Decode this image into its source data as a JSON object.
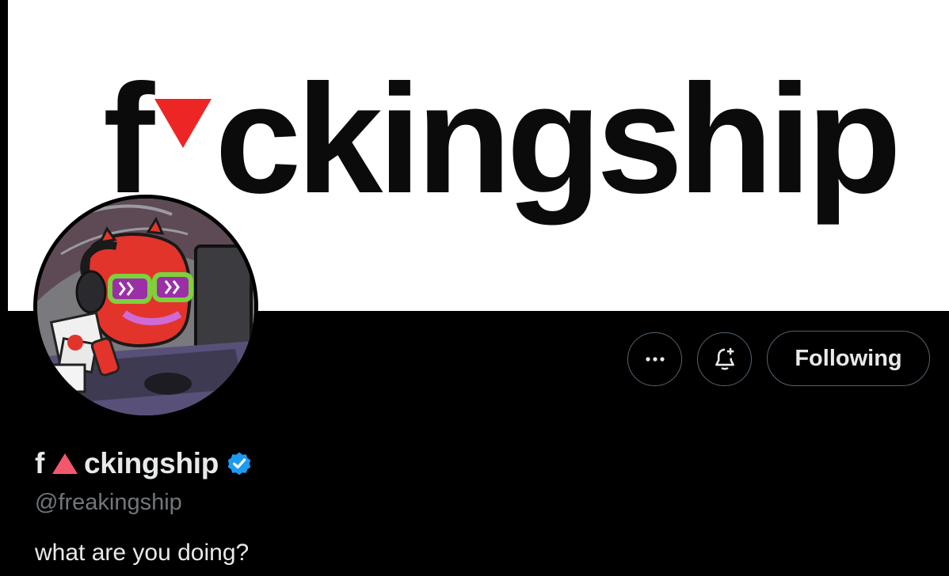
{
  "banner": {
    "logo_left": "f",
    "logo_right": "ckingship",
    "accent_color": "#ee2525"
  },
  "profile": {
    "name_left": "f",
    "name_right": "ckingship",
    "name_accent_color": "#f4576b",
    "verified_color": "#1d9bf0",
    "handle": "@freakingship",
    "bio": "what are you doing?"
  },
  "actions": {
    "more_icon": "more-icon",
    "notify_icon": "bell-plus-icon",
    "following_label": "Following"
  }
}
